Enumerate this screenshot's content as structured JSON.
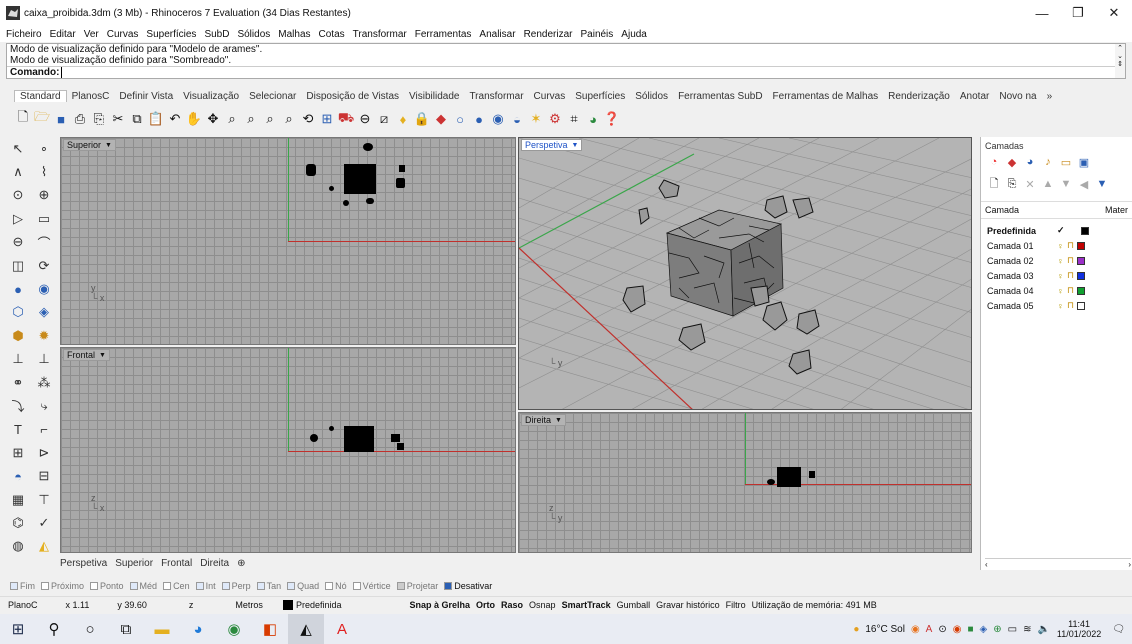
{
  "window": {
    "title": "caixa_proibida.3dm (3 Mb) - Rhinoceros 7 Evaluation (34 Dias Restantes)",
    "min": "—",
    "max": "❐",
    "close": "✕"
  },
  "menu": [
    "Ficheiro",
    "Editar",
    "Ver",
    "Curvas",
    "Superfícies",
    "SubD",
    "Sólidos",
    "Malhas",
    "Cotas",
    "Transformar",
    "Ferramentas",
    "Analisar",
    "Renderizar",
    "Painéis",
    "Ajuda"
  ],
  "command": {
    "history": [
      "Modo de visualização definido para \"Modelo de arames\".",
      "Modo de visualização definido para \"Sombreado\"."
    ],
    "prompt": "Comando:"
  },
  "tabs": [
    "Standard",
    "PlanosC",
    "Definir Vista",
    "Visualização",
    "Selecionar",
    "Disposição de Vistas",
    "Visibilidade",
    "Transformar",
    "Curvas",
    "Superfícies",
    "Sólidos",
    "Ferramentas SubD",
    "Ferramentas de Malhas",
    "Renderização",
    "Anotar",
    "Novo na",
    "»"
  ],
  "viewports": {
    "top": "Superior",
    "front": "Frontal",
    "perspective": "Perspetiva",
    "right": "Direita"
  },
  "viewport_tabs": [
    "Perspetiva",
    "Superior",
    "Frontal",
    "Direita",
    "⊕"
  ],
  "layers": {
    "panel_title": "Camadas",
    "col_layer": "Camada",
    "col_material": "Mater",
    "rows": [
      {
        "name": "Predefinida",
        "check": "✓",
        "color": "#000000",
        "bold": true
      },
      {
        "name": "Camada 01",
        "color": "#c00000"
      },
      {
        "name": "Camada 02",
        "color": "#9b30c8"
      },
      {
        "name": "Camada 03",
        "color": "#1030e0"
      },
      {
        "name": "Camada 04",
        "color": "#10a030"
      },
      {
        "name": "Camada 05",
        "color": "#ffffff"
      }
    ]
  },
  "osnaps": [
    {
      "label": "Fim",
      "checked": true
    },
    {
      "label": "Próximo",
      "checked": false
    },
    {
      "label": "Ponto",
      "checked": false
    },
    {
      "label": "Méd",
      "checked": true
    },
    {
      "label": "Cen",
      "checked": false
    },
    {
      "label": "Int",
      "checked": true
    },
    {
      "label": "Perp",
      "checked": true
    },
    {
      "label": "Tan",
      "checked": true
    },
    {
      "label": "Quad",
      "checked": true
    },
    {
      "label": "Nó",
      "checked": false
    },
    {
      "label": "Vértice",
      "checked": false
    },
    {
      "label": "Projetar",
      "checked": false
    },
    {
      "label": "Desativar",
      "checked": true
    }
  ],
  "status": {
    "cplane": "PlanoC",
    "x": "x 1.11",
    "y": "y 39.60",
    "z": "z",
    "units": "Metros",
    "layer": "Predefinida",
    "toggles": [
      "Snap à Grelha",
      "Orto",
      "Raso",
      "Osnap",
      "SmartTrack",
      "Gumball",
      "Gravar histórico",
      "Filtro"
    ],
    "memory": "Utilização de memória: 491 MB"
  },
  "taskbar": {
    "weather": "16°C Sol",
    "time": "11:41",
    "date": "11/01/2022"
  }
}
